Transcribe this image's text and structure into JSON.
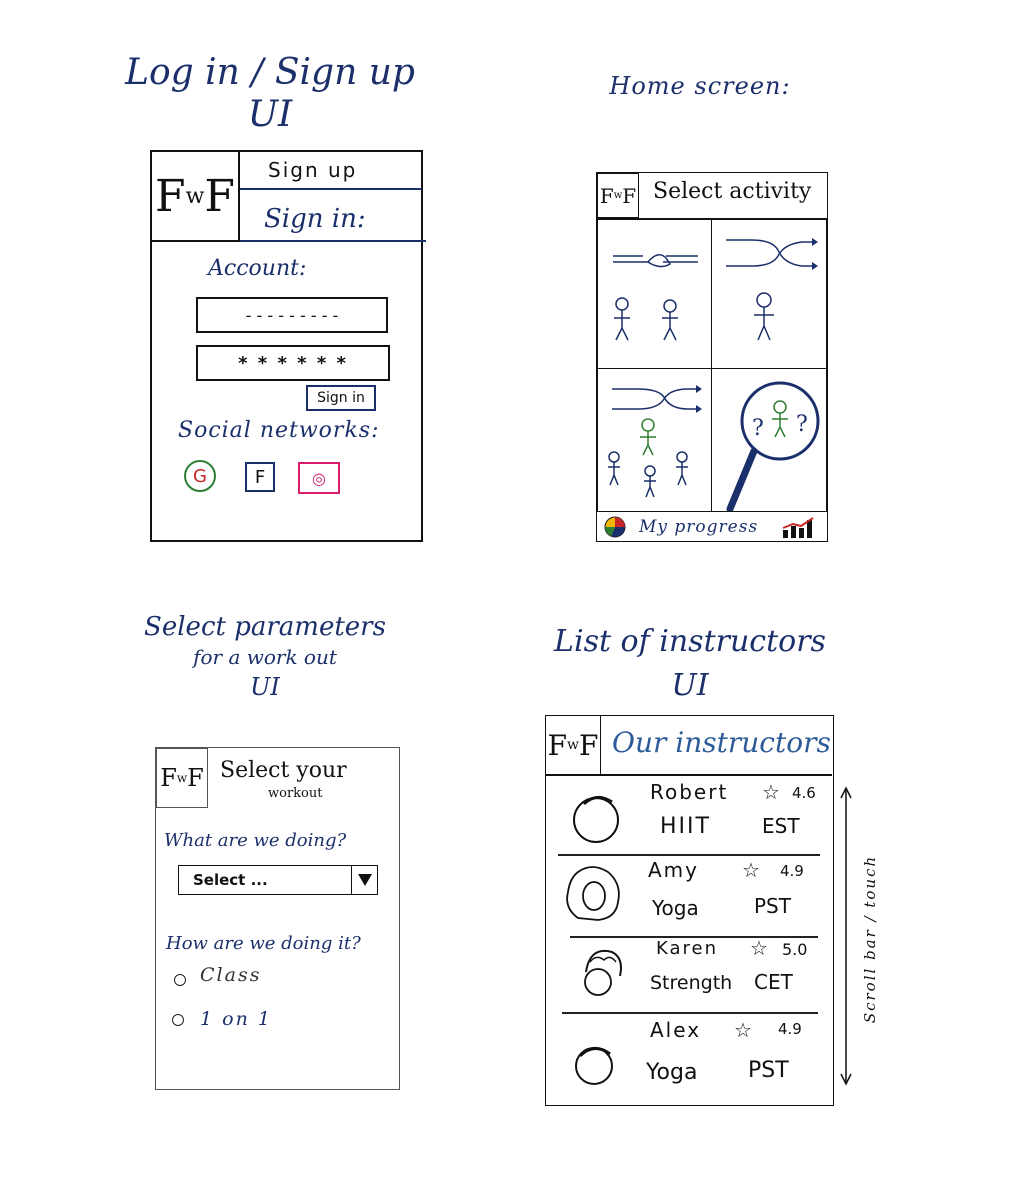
{
  "sections": {
    "login_title": [
      "Log in / Sign up",
      "UI"
    ],
    "home_title": "Home screen:",
    "params_title": [
      "Select parameters",
      "for a work out",
      "UI"
    ],
    "instructors_title": [
      "List of instructors",
      "UI"
    ]
  },
  "logo": {
    "main": "FwF",
    "left": "F",
    "small": "w",
    "right": "F"
  },
  "login": {
    "tab_signup": "Sign up",
    "tab_signin": "Sign in:",
    "account_label": "Account:",
    "account_placeholder": "- - - - - - - - -",
    "password_mask": "* * * * * *",
    "signin_button": "Sign in",
    "social_label": "Social networks:",
    "social": [
      {
        "letter": "G",
        "color": "#2f7d32"
      },
      {
        "letter": "F",
        "color": "#1b2f6b"
      },
      {
        "letter": "◎",
        "color": "#d61c6b"
      }
    ]
  },
  "home": {
    "header": "Select activity",
    "footer_progress": "My progress",
    "tiles": [
      "partner-workout",
      "solo-workout",
      "group-class",
      "find-instructor"
    ]
  },
  "params": {
    "header_line1": "Select your",
    "header_line2": "workout",
    "question1": "What are we doing?",
    "select_placeholder": "Select ...",
    "question2": "How are we doing it?",
    "options": [
      "Class",
      "1 on 1"
    ]
  },
  "instructors": {
    "header": "Our instructors",
    "scroll_label": "Scroll bar / touch",
    "list": [
      {
        "name": "Robert",
        "rating": "4.6",
        "type": "HIIT",
        "tz": "EST"
      },
      {
        "name": "Amy",
        "rating": "4.9",
        "type": "Yoga",
        "tz": "PST"
      },
      {
        "name": "Karen",
        "rating": "5.0",
        "type": "Strength",
        "tz": "CET"
      },
      {
        "name": "Alex",
        "rating": "4.9",
        "type": "Yoga",
        "tz": "PST"
      }
    ]
  },
  "colors": {
    "ink": "#1b2f6b",
    "green": "#2f7d32",
    "pink": "#d61c6b"
  }
}
